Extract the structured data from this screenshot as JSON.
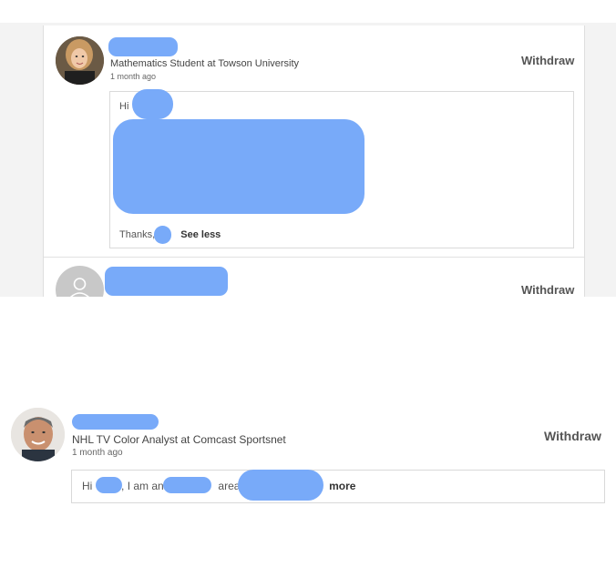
{
  "connection_1": {
    "headline": "Mathematics Student at Towson University",
    "time": "1 month ago",
    "withdraw_label": "Withdraw",
    "message": {
      "greeting": "Hi",
      "signoff": "Thanks,",
      "toggle_label": "See less"
    }
  },
  "connection_2": {
    "withdraw_label": "Withdraw"
  },
  "connection_3": {
    "headline": "NHL TV Color Analyst at Comcast Sportsnet",
    "time": "1 month ago",
    "withdraw_label": "Withdraw",
    "message": {
      "greeting": "Hi",
      "part1": ", I am an",
      "part2": "area",
      "toggle_label": "more"
    }
  },
  "colors": {
    "redaction": "#78aaf9",
    "panel_background": "#f3f3f3"
  }
}
